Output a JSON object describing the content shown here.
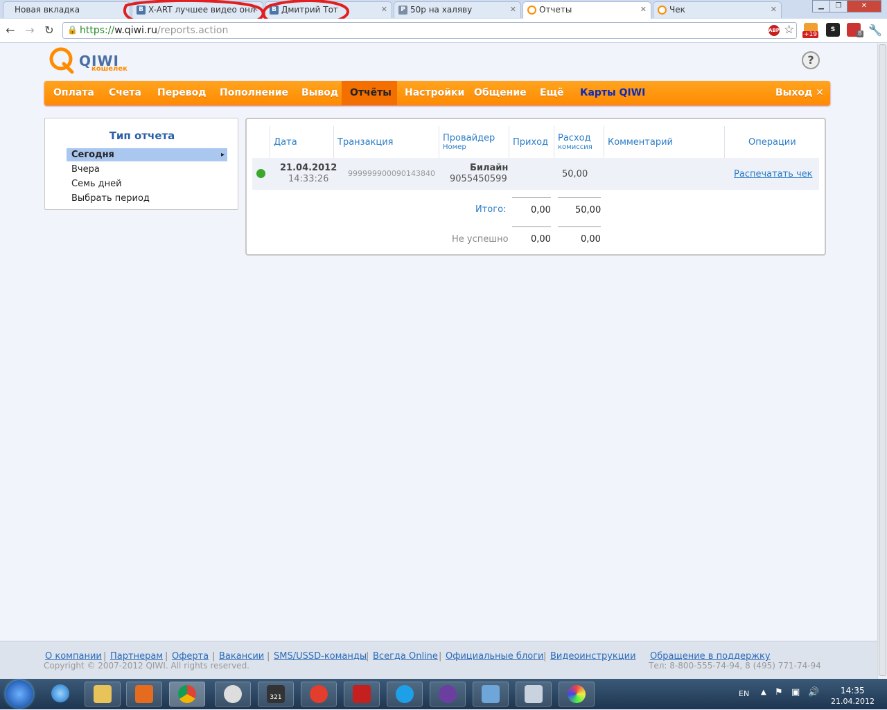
{
  "browser": {
    "tabs": [
      {
        "title": "Новая вкладка",
        "favicon": "none",
        "active": false
      },
      {
        "title": "X-ART лучшее видео онл",
        "favicon": "vk-icon",
        "active": false
      },
      {
        "title": "Дмитрий Тот",
        "favicon": "vk-icon",
        "active": false
      },
      {
        "title": "50р на халяву",
        "favicon": "pd-icon",
        "active": false
      },
      {
        "title": "Отчеты",
        "favicon": "qiwi-icon",
        "active": true
      },
      {
        "title": "Чек",
        "favicon": "qiwi-icon",
        "active": false
      }
    ],
    "url": {
      "scheme": "https://",
      "host": "w.qiwi.ru",
      "path": "/reports.action"
    },
    "extension_badge": "+19",
    "extension_badge2": "8"
  },
  "logo": {
    "brand": "QIWI",
    "sub": "кошелек"
  },
  "help_label": "?",
  "menu": {
    "items": [
      "Оплата",
      "Счета",
      "Перевод",
      "Пополнение",
      "Вывод",
      "Отчёты",
      "Настройки",
      "Общение",
      "Ещё"
    ],
    "active": "Отчёты",
    "cards": "Карты QIWI",
    "logout": "Выход",
    "logout_icon": "✕"
  },
  "sidebar": {
    "title": "Тип отчета",
    "items": [
      "Сегодня",
      "Вчера",
      "Семь дней",
      "Выбрать период"
    ],
    "selected": "Сегодня"
  },
  "report": {
    "columns": {
      "date": "Дата",
      "transaction": "Транзакция",
      "provider": "Провайдер",
      "provider_sub": "Номер",
      "income": "Приход",
      "expense": "Расход",
      "expense_sub": "комиссия",
      "comment": "Комментарий",
      "operations": "Операции"
    },
    "rows": [
      {
        "status_color": "#3aa82a",
        "date": "21.04.2012",
        "time": "14:33:26",
        "transaction": "999999900090143840",
        "provider": "Билайн",
        "number": "9055450599",
        "income": "",
        "expense": "50,00",
        "comment": "",
        "action": "Распечатать чек"
      }
    ],
    "totals": {
      "label": "Итого:",
      "income": "0,00",
      "expense": "50,00",
      "failed_label": "Не успешно",
      "failed_income": "0,00",
      "failed_expense": "0,00"
    }
  },
  "footer": {
    "links": [
      "О компании",
      "Партнерам",
      "Оферта",
      "Вакансии",
      "SMS/USSD-команды",
      "Всегда Online",
      "Официальные блоги",
      "Видеоинструкции"
    ],
    "support": "Обращение в поддержку",
    "copyright": "Copyright © 2007-2012 QIWI. All rights reserved.",
    "phone": "Тел: 8-800-555-74-94, 8 (495) 771-74-94"
  },
  "taskbar": {
    "lang": "EN",
    "time": "14:35",
    "date": "21.04.2012",
    "badge": "321"
  },
  "colors": {
    "accent": "#ff9600",
    "link": "#2a7cc7",
    "cards": "#0c2ab8"
  }
}
